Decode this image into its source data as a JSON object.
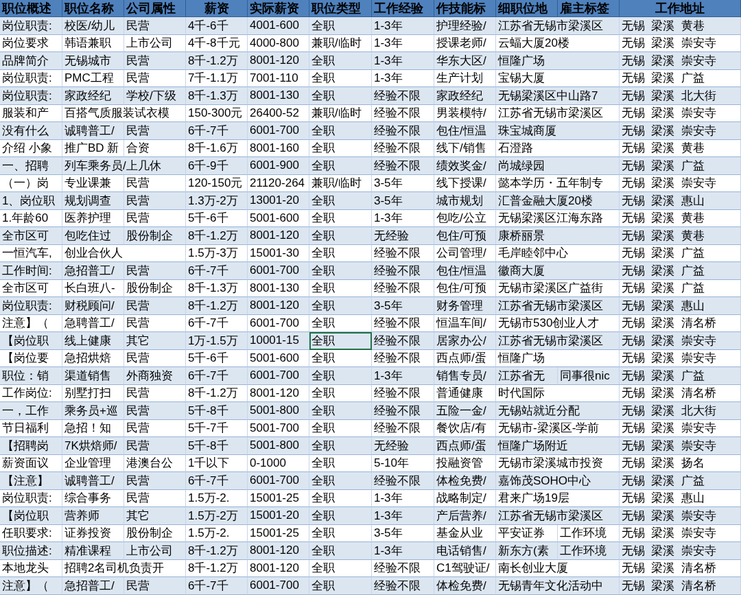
{
  "table": {
    "columns": [
      "职位概述",
      "职位名称",
      "公司属性",
      "薪资",
      "实际薪资",
      "职位类型",
      "工作经验",
      "作技能标",
      "细职位地",
      "雇主标签",
      "工作地址"
    ],
    "rows": [
      {
        "cells": [
          "岗位职责:",
          "校医/幼儿",
          "民营",
          "4千-6千",
          "4001-600",
          "全职",
          "1-3年",
          "护理经验/",
          "江苏省无锡市梁溪区",
          null,
          "无锡  梁溪  黄巷"
        ]
      },
      {
        "cells": [
          "岗位要求",
          "韩语兼职",
          "上市公司",
          "4千-8千元",
          "4000-800",
          "兼职/临时",
          "1-3年",
          "授课老师/",
          "云蝠大厦20楼",
          null,
          "无锡  梁溪  崇安寺"
        ]
      },
      {
        "cells": [
          "品牌简介",
          "无锡城市",
          "民营",
          "8千-1.2万",
          "8001-120",
          "全职",
          "1-3年",
          "华东大区/",
          "恒隆广场",
          null,
          "无锡  梁溪  崇安寺"
        ]
      },
      {
        "cells": [
          "岗位职责:",
          "PMC工程",
          "民营",
          "7千-1.1万",
          "7001-110",
          "全职",
          "1-3年",
          "生产计划",
          "宝锡大厦",
          null,
          "无锡  梁溪  广益"
        ]
      },
      {
        "cells": [
          "岗位职责:",
          "家政经纪",
          "学校/下级",
          "8千-1.3万",
          "8001-130",
          "全职",
          "经验不限",
          "家政经纪",
          "无锡梁溪区中山路7",
          null,
          "无锡  梁溪  北大街"
        ]
      },
      {
        "cells": [
          "服装和产",
          "百搭气质服装试衣模",
          null,
          "150-300元",
          "26400-52",
          "兼职/临时",
          "经验不限",
          "男装模特/",
          "江苏省无锡市梁溪区",
          null,
          "无锡  梁溪  崇安寺"
        ]
      },
      {
        "cells": [
          "没有什么",
          "诚聘普工/",
          "民营",
          "6千-7千",
          "6001-700",
          "全职",
          "经验不限",
          "包住/恒温",
          "珠宝城商厦",
          null,
          "无锡  梁溪  崇安寺"
        ]
      },
      {
        "cells": [
          "介绍 小象",
          "推广BD 新",
          "合资",
          "8千-1.6万",
          "8001-160",
          "全职",
          "经验不限",
          "线下/销售",
          "石澄路",
          null,
          "无锡  梁溪  黄巷"
        ]
      },
      {
        "cells": [
          "一、招聘",
          "列车乘务员/上几休",
          null,
          "6千-9千",
          "6001-900",
          "全职",
          "经验不限",
          "绩效奖金/",
          "尚城绿园",
          null,
          "无锡  梁溪  广益"
        ]
      },
      {
        "cells": [
          "（一）岗",
          "专业课兼",
          "民营",
          "120-150元",
          "21120-264",
          "兼职/临时",
          "3-5年",
          "线下授课/",
          "懿本学历・五年制专",
          null,
          "无锡  梁溪  崇安寺"
        ]
      },
      {
        "cells": [
          "1、岗位职",
          "规划调查",
          "民营",
          "1.3万-2万",
          "13001-20",
          "全职",
          "3-5年",
          "城市规划",
          "汇普金融大厦20楼",
          null,
          "无锡  梁溪  惠山"
        ]
      },
      {
        "cells": [
          "1.年龄60",
          "医养护理",
          "民营",
          "5千-6千",
          "5001-600",
          "全职",
          "1-3年",
          "包吃/公立",
          "无锡梁溪区江海东路",
          null,
          "无锡  梁溪  黄巷"
        ]
      },
      {
        "cells": [
          "全市区可",
          "包吃住过",
          "股份制企",
          "8千-1.2万",
          "8001-120",
          "全职",
          "无经验",
          "包住/可预",
          "康桥丽景",
          null,
          "无锡  梁溪  黄巷"
        ]
      },
      {
        "cells": [
          "一恒汽车,",
          "创业合伙人",
          null,
          "1.5万-3万",
          "15001-30",
          "全职",
          "经验不限",
          "公司管理/",
          "毛岸睦邻中心",
          null,
          "无锡  梁溪  广益"
        ]
      },
      {
        "cells": [
          "工作时间:",
          "急招普工/",
          "民营",
          "6千-7千",
          "6001-700",
          "全职",
          "经验不限",
          "包住/恒温",
          "徽商大厦",
          null,
          "无锡  梁溪  广益"
        ]
      },
      {
        "cells": [
          "全市区可",
          "长白班八-",
          "股份制企",
          "8千-1.3万",
          "8001-130",
          "全职",
          "经验不限",
          "包住/可预",
          "无锡市梁溪区广益街",
          null,
          "无锡  梁溪  广益"
        ]
      },
      {
        "cells": [
          "岗位职责:",
          "财税顾问/",
          "民营",
          "8千-1.2万",
          "8001-120",
          "全职",
          "3-5年",
          "财务管理",
          "江苏省无锡市梁溪区",
          null,
          "无锡  梁溪  惠山"
        ]
      },
      {
        "cells": [
          "注意】（",
          "急聘普工/",
          "民营",
          "6千-7千",
          "6001-700",
          "全职",
          "经验不限",
          "恒温车间/",
          "无锡市530创业人才",
          null,
          "无锡  梁溪  清名桥"
        ]
      },
      {
        "cells": [
          "【岗位职",
          "线上健康",
          "其它",
          "1万-1.5万",
          "10001-15",
          {
            "text": "全职",
            "selected": true
          },
          "经验不限",
          "居家办公/",
          "江苏省无锡市梁溪区",
          null,
          "无锡  梁溪  崇安寺"
        ]
      },
      {
        "cells": [
          "【岗位要",
          "急招烘焙",
          "民营",
          "5千-6千",
          "5001-600",
          "全职",
          "经验不限",
          "西点师/蛋",
          "恒隆广场",
          null,
          "无锡  梁溪  崇安寺"
        ]
      },
      {
        "cells": [
          "职位：销",
          "渠道销售",
          "外商独资",
          "6千-7千",
          "6001-700",
          "全职",
          "1-3年",
          "销售专员/",
          "江苏省无",
          "同事很nic",
          "无锡  梁溪  广益"
        ]
      },
      {
        "cells": [
          "工作岗位:",
          "别墅打扫",
          "民营",
          "8千-1.2万",
          "8001-120",
          "全职",
          "经验不限",
          "普通健康",
          "时代国际",
          null,
          "无锡  梁溪  清名桥"
        ]
      },
      {
        "cells": [
          "一，工作",
          "乘务员+巡",
          "民营",
          "5千-8千",
          "5001-800",
          "全职",
          "经验不限",
          "五险一金/",
          "无锡站就近分配",
          null,
          "无锡  梁溪  北大街"
        ]
      },
      {
        "cells": [
          "节日福利",
          "急招！知",
          "民营",
          "5千-7千",
          "5001-700",
          "全职",
          "经验不限",
          "餐饮店/有",
          "无锡市-梁溪区-学前",
          null,
          "无锡  梁溪  崇安寺"
        ]
      },
      {
        "cells": [
          "【招聘岗",
          "7K烘焙师/",
          "民营",
          "5千-8千",
          "5001-800",
          "全职",
          "无经验",
          "西点师/蛋",
          "恒隆广场附近",
          null,
          "无锡  梁溪  崇安寺"
        ]
      },
      {
        "cells": [
          "薪资面议",
          "企业管理",
          "港澳台公",
          "1千以下",
          "0-1000",
          "全职",
          "5-10年",
          "投融资管",
          "无锡市梁溪城市投资",
          null,
          "无锡  梁溪  扬名"
        ]
      },
      {
        "cells": [
          "【注意】",
          "诚聘普工/",
          "民营",
          "6千-7千",
          "6001-700",
          "全职",
          "经验不限",
          "体检免费/",
          "嘉饰茂SOHO中心",
          null,
          "无锡  梁溪  广益"
        ]
      },
      {
        "cells": [
          "岗位职责:",
          "综合事务",
          "民营",
          "1.5万-2.",
          "15001-25",
          "全职",
          "1-3年",
          "战略制定/",
          "君来广场19层",
          null,
          "无锡  梁溪  惠山"
        ]
      },
      {
        "cells": [
          "【岗位职",
          "营养师",
          "其它",
          "1.5万-2万",
          "15001-20",
          "全职",
          "1-3年",
          "产后营养/",
          "江苏省无锡市梁溪区",
          null,
          "无锡  梁溪  崇安寺"
        ]
      },
      {
        "cells": [
          "任职要求:",
          "证券投资",
          "股份制企",
          "1.5万-2.",
          "15001-25",
          "全职",
          "3-5年",
          "基金从业",
          "平安证券",
          "工作环境",
          "无锡  梁溪  崇安寺"
        ]
      },
      {
        "cells": [
          "职位描述:",
          "精准课程",
          "上市公司",
          "8千-1.2万",
          "8001-120",
          "全职",
          "1-3年",
          "电话销售/",
          "新东方(素",
          "工作环境",
          "无锡  梁溪  崇安寺"
        ]
      },
      {
        "cells": [
          "本地龙头",
          "招聘2名司机负责开",
          null,
          "8千-1.2万",
          "8001-120",
          "全职",
          "经验不限",
          "C1驾驶证/",
          "南长创业大厦",
          null,
          "无锡  梁溪  清名桥"
        ]
      },
      {
        "cells": [
          "注意】（",
          "急招普工/",
          "民营",
          "6千-7千",
          "6001-700",
          "全职",
          "经验不限",
          "体检免费/",
          "无锡青年文化活动中",
          null,
          "无锡  梁溪  清名桥"
        ]
      }
    ]
  }
}
